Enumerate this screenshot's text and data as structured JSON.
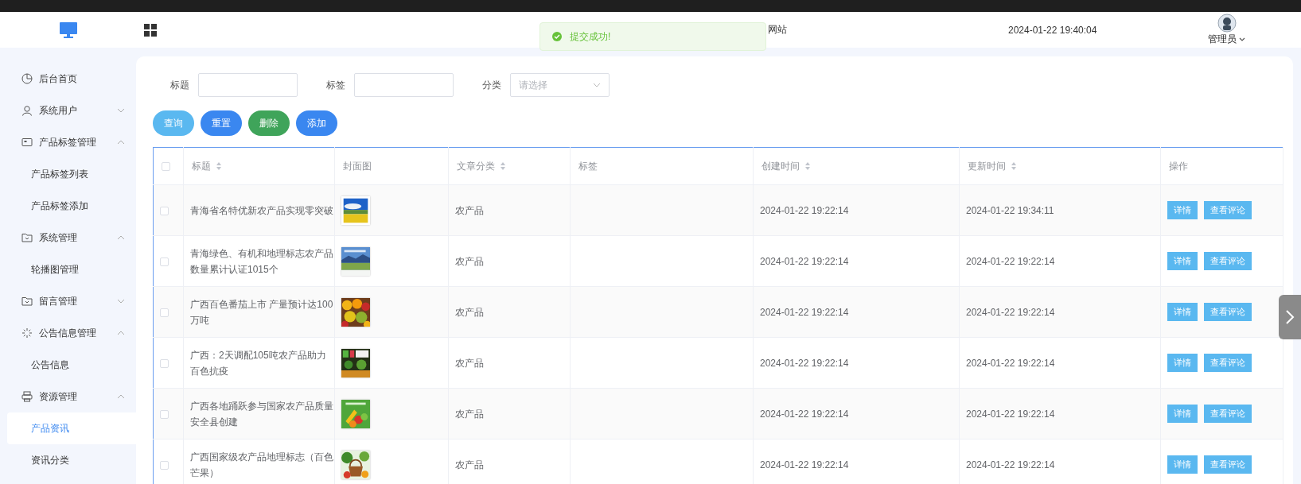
{
  "header": {
    "title": "网站",
    "datetime": "2024-01-22 19:40:04",
    "user": "管理员"
  },
  "toast": {
    "kind": "success",
    "message": "提交成功!"
  },
  "sidebar": {
    "items": [
      {
        "label": "后台首页"
      },
      {
        "label": "系统用户",
        "expanded": false
      },
      {
        "label": "产品标签管理",
        "expanded": true,
        "children": [
          {
            "label": "产品标签列表",
            "selected": false
          },
          {
            "label": "产品标签添加",
            "selected": false
          }
        ]
      },
      {
        "label": "系统管理",
        "expanded": true,
        "children": [
          {
            "label": "轮播图管理",
            "selected": false
          }
        ]
      },
      {
        "label": "留言管理",
        "expanded": false
      },
      {
        "label": "公告信息管理",
        "expanded": true,
        "children": [
          {
            "label": "公告信息",
            "selected": false
          }
        ]
      },
      {
        "label": "资源管理",
        "expanded": true,
        "children": [
          {
            "label": "产品资讯",
            "selected": true
          },
          {
            "label": "资讯分类",
            "selected": false
          }
        ]
      }
    ]
  },
  "filters": [
    {
      "kind": "text",
      "label": "标题"
    },
    {
      "kind": "text",
      "label": "标签"
    },
    {
      "kind": "select",
      "label": "分类",
      "placeholder": "请选择"
    }
  ],
  "buttons": [
    {
      "label": "查询",
      "color": "#5ab8f0"
    },
    {
      "label": "重置",
      "color": "#3a87f0"
    },
    {
      "label": "删除",
      "color": "#3fa45a"
    },
    {
      "label": "添加",
      "color": "#3a87f0"
    }
  ],
  "table": {
    "all_checked": false,
    "columns": [
      {
        "kind": "checkbox"
      },
      {
        "kind": "text",
        "label": "标题",
        "sortable": true
      },
      {
        "kind": "picture",
        "label": "封面图",
        "sortable": false
      },
      {
        "kind": "text",
        "label": "文章分类",
        "sortable": true
      },
      {
        "kind": "text",
        "label": "标签",
        "sortable": false
      },
      {
        "kind": "text",
        "label": "创建时间",
        "sortable": true
      },
      {
        "kind": "text",
        "label": "更新时间",
        "sortable": true
      },
      {
        "kind": "actions",
        "label": "操作",
        "sortable": false
      }
    ],
    "rows": [
      {
        "checked": false,
        "title": "青海省名特优新农产品实现零突破",
        "cover": {
          "kind": "picture"
        },
        "category": "农产品",
        "created": "2024-01-22 19:22:14",
        "updated": "2024-01-22 19:34:11",
        "actions": [
          "详情",
          "查看评论"
        ]
      },
      {
        "checked": false,
        "title": "青海绿色、有机和地理标志农产品数量累计认证1015个",
        "cover": {
          "kind": "picture"
        },
        "category": "农产品",
        "created": "2024-01-22 19:22:14",
        "updated": "2024-01-22 19:22:14",
        "actions": [
          "详情",
          "查看评论"
        ]
      },
      {
        "checked": false,
        "title": "广西百色番茄上市 产量预计达100万吨",
        "cover": {
          "kind": "picture"
        },
        "category": "农产品",
        "created": "2024-01-22 19:22:14",
        "updated": "2024-01-22 19:22:14",
        "actions": [
          "详情",
          "查看评论"
        ]
      },
      {
        "checked": false,
        "title": "广西：2天调配105吨农产品助力百色抗疫",
        "cover": {
          "kind": "picture"
        },
        "category": "农产品",
        "created": "2024-01-22 19:22:14",
        "updated": "2024-01-22 19:22:14",
        "actions": [
          "详情",
          "查看评论"
        ]
      },
      {
        "checked": false,
        "title": "广西各地踊跃参与国家农产品质量安全县创建",
        "cover": {
          "kind": "picture"
        },
        "category": "农产品",
        "created": "2024-01-22 19:22:14",
        "updated": "2024-01-22 19:22:14",
        "actions": [
          "详情",
          "查看评论"
        ]
      },
      {
        "checked": false,
        "title": "广西国家级农产品地理标志（百色芒果）",
        "cover": {
          "kind": "picture"
        },
        "category": "农产品",
        "created": "2024-01-22 19:22:14",
        "updated": "2024-01-22 19:22:14",
        "actions": [
          "详情",
          "查看评论"
        ]
      }
    ]
  }
}
